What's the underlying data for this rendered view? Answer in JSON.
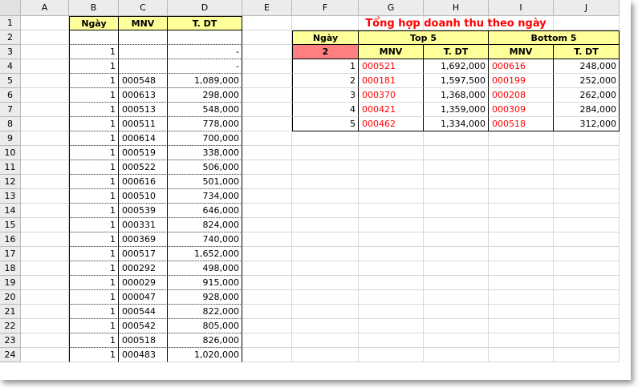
{
  "columns": [
    "A",
    "B",
    "C",
    "D",
    "E",
    "F",
    "G",
    "H",
    "I",
    "J"
  ],
  "rows": [
    "1",
    "2",
    "3",
    "4",
    "5",
    "6",
    "7",
    "8",
    "9",
    "10",
    "11",
    "12",
    "13",
    "14",
    "15",
    "16",
    "17",
    "18",
    "19",
    "20",
    "21",
    "22",
    "23",
    "24"
  ],
  "left_table": {
    "headers": [
      "Ngày",
      "MNV",
      "T. DT"
    ],
    "rows": [
      [
        "",
        "",
        ""
      ],
      [
        "1",
        "",
        "-"
      ],
      [
        "1",
        "",
        "-"
      ],
      [
        "1",
        "000548",
        "1,089,000"
      ],
      [
        "1",
        "000613",
        "298,000"
      ],
      [
        "1",
        "000513",
        "548,000"
      ],
      [
        "1",
        "000511",
        "778,000"
      ],
      [
        "1",
        "000614",
        "700,000"
      ],
      [
        "1",
        "000519",
        "338,000"
      ],
      [
        "1",
        "000522",
        "506,000"
      ],
      [
        "1",
        "000616",
        "501,000"
      ],
      [
        "1",
        "000510",
        "734,000"
      ],
      [
        "1",
        "000539",
        "646,000"
      ],
      [
        "1",
        "000331",
        "824,000"
      ],
      [
        "1",
        "000369",
        "740,000"
      ],
      [
        "1",
        "000517",
        "1,652,000"
      ],
      [
        "1",
        "000292",
        "498,000"
      ],
      [
        "1",
        "000029",
        "915,000"
      ],
      [
        "1",
        "000047",
        "928,000"
      ],
      [
        "1",
        "000544",
        "822,000"
      ],
      [
        "1",
        "000542",
        "805,000"
      ],
      [
        "1",
        "000518",
        "826,000"
      ],
      [
        "1",
        "000483",
        "1,020,000"
      ]
    ]
  },
  "summary": {
    "title": "Tổng hợp doanh thu theo ngày",
    "day_label": "Ngày",
    "day_value": "2",
    "top_label": "Top 5",
    "bottom_label": "Bottom 5",
    "sub_headers": [
      "MNV",
      "T. DT",
      "MNV",
      "T. DT"
    ],
    "rows": [
      [
        "1",
        "000521",
        "1,692,000",
        "000616",
        "248,000"
      ],
      [
        "2",
        "000181",
        "1,597,500",
        "000199",
        "252,000"
      ],
      [
        "3",
        "000370",
        "1,368,000",
        "000208",
        "262,000"
      ],
      [
        "4",
        "000421",
        "1,359,000",
        "000309",
        "284,000"
      ],
      [
        "5",
        "000462",
        "1,334,000",
        "000518",
        "312,000"
      ]
    ]
  }
}
